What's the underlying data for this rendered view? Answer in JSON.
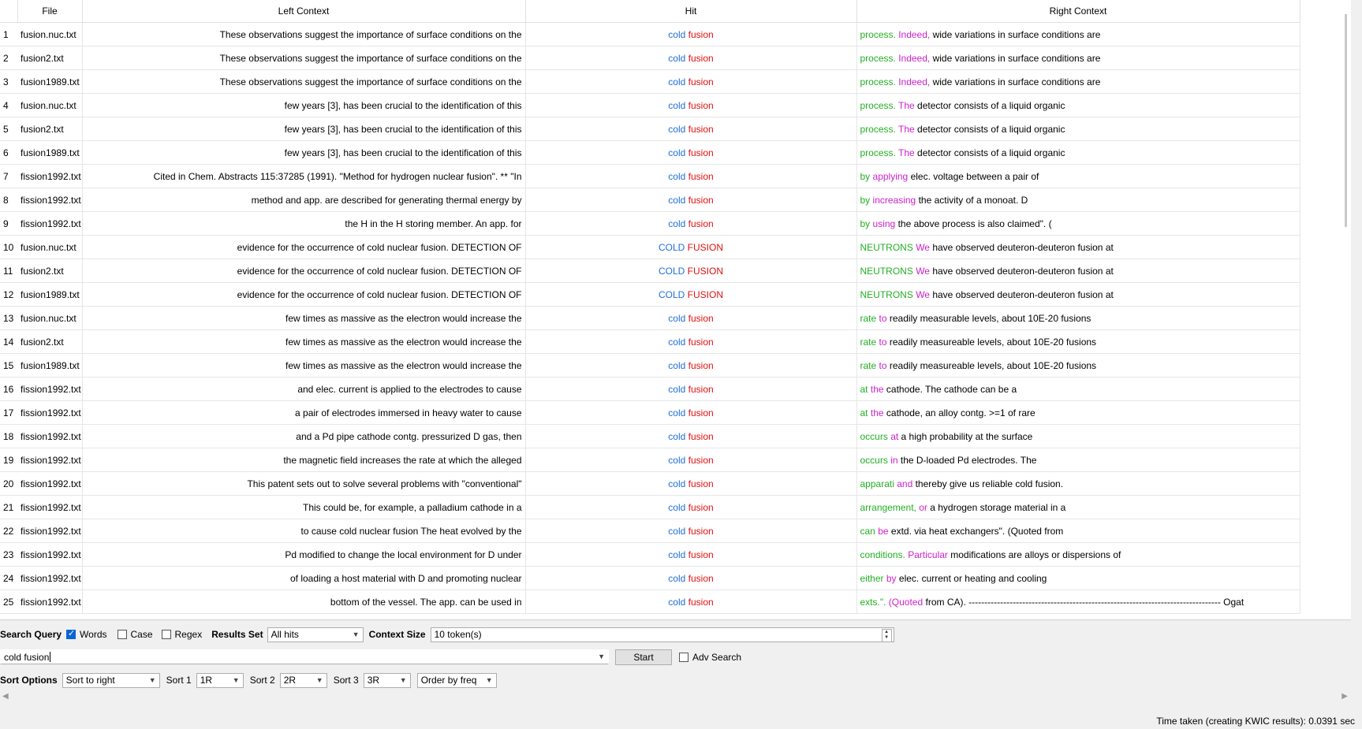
{
  "table": {
    "headers": {
      "file": "File",
      "left": "Left Context",
      "hit": "Hit",
      "right": "Right Context"
    },
    "rows": [
      {
        "n": "1",
        "file": "fusion.nuc.txt",
        "left": "These observations suggest the importance of surface conditions on the",
        "hit": [
          "cold",
          "fusion"
        ],
        "r1": "process.",
        "r2": "Indeed,",
        "rest": "wide variations in surface conditions are"
      },
      {
        "n": "2",
        "file": "fusion2.txt",
        "left": "These observations suggest the importance of surface conditions on the",
        "hit": [
          "cold",
          "fusion"
        ],
        "r1": "process.",
        "r2": "Indeed,",
        "rest": "wide variations in surface conditions are"
      },
      {
        "n": "3",
        "file": "fusion1989.txt",
        "left": "These observations suggest the importance of surface conditions on the",
        "hit": [
          "cold",
          "fusion"
        ],
        "r1": "process.",
        "r2": "Indeed,",
        "rest": "wide variations in surface conditions are"
      },
      {
        "n": "4",
        "file": "fusion.nuc.txt",
        "left": "few years [3], has been crucial to the identification of this",
        "hit": [
          "cold",
          "fusion"
        ],
        "r1": "process.",
        "r2": "The",
        "rest": "detector consists of a liquid organic"
      },
      {
        "n": "5",
        "file": "fusion2.txt",
        "left": "few years [3], has been crucial to the identification of this",
        "hit": [
          "cold",
          "fusion"
        ],
        "r1": "process.",
        "r2": "The",
        "rest": "detector consists of a liquid organic"
      },
      {
        "n": "6",
        "file": "fusion1989.txt",
        "left": "few years [3], has been crucial to the identification of this",
        "hit": [
          "cold",
          "fusion"
        ],
        "r1": "process.",
        "r2": "The",
        "rest": "detector consists of a liquid organic"
      },
      {
        "n": "7",
        "file": "fission1992.txt",
        "left": "Cited in Chem. Abstracts 115:37285 (1991). \"Method for hydrogen nuclear fusion\". ** \"In",
        "hit": [
          "cold",
          "fusion"
        ],
        "r1": "by",
        "r2": "applying",
        "rest": "elec. voltage between a pair of"
      },
      {
        "n": "8",
        "file": "fission1992.txt",
        "left": "method and app. are described for generating thermal energy by",
        "hit": [
          "cold",
          "fusion"
        ],
        "r1": "by",
        "r2": "increasing",
        "rest": "the activity of a monoat. D"
      },
      {
        "n": "9",
        "file": "fission1992.txt",
        "left": "the H in the H storing member. An app. for",
        "hit": [
          "cold",
          "fusion"
        ],
        "r1": "by",
        "r2": "using",
        "rest": "the above process is also claimed\". ("
      },
      {
        "n": "10",
        "file": "fusion.nuc.txt",
        "left": "evidence for the occurrence of cold nuclear fusion. DETECTION OF",
        "hit": [
          "COLD",
          "FUSION"
        ],
        "r1": "NEUTRONS",
        "r2": "We",
        "rest": "have observed deuteron-deuteron fusion at"
      },
      {
        "n": "11",
        "file": "fusion2.txt",
        "left": "evidence for the occurrence of cold nuclear fusion. DETECTION OF",
        "hit": [
          "COLD",
          "FUSION"
        ],
        "r1": "NEUTRONS",
        "r2": "We",
        "rest": "have observed deuteron-deuteron fusion at"
      },
      {
        "n": "12",
        "file": "fusion1989.txt",
        "left": "evidence for the occurrence of cold nuclear fusion. DETECTION OF",
        "hit": [
          "COLD",
          "FUSION"
        ],
        "r1": "NEUTRONS",
        "r2": "We",
        "rest": "have observed deuteron-deuteron fusion at"
      },
      {
        "n": "13",
        "file": "fusion.nuc.txt",
        "left": "few times as massive as the electron would increase the",
        "hit": [
          "cold",
          "fusion"
        ],
        "r1": "rate",
        "r2": "to",
        "rest": "readily measurable levels, about 10E-20 fusions"
      },
      {
        "n": "14",
        "file": "fusion2.txt",
        "left": "few times as massive as the electron would increase the",
        "hit": [
          "cold",
          "fusion"
        ],
        "r1": "rate",
        "r2": "to",
        "rest": "readily measureable levels, about 10E-20 fusions"
      },
      {
        "n": "15",
        "file": "fusion1989.txt",
        "left": "few times as massive as the electron would increase the",
        "hit": [
          "cold",
          "fusion"
        ],
        "r1": "rate",
        "r2": "to",
        "rest": "readily measureable levels, about 10E-20 fusions"
      },
      {
        "n": "16",
        "file": "fission1992.txt",
        "left": "and elec. current is applied to the electrodes to cause",
        "hit": [
          "cold",
          "fusion"
        ],
        "r1": "at",
        "r2": "the",
        "rest": "cathode. The cathode can be a"
      },
      {
        "n": "17",
        "file": "fission1992.txt",
        "left": "a pair of electrodes immersed in heavy water to cause",
        "hit": [
          "cold",
          "fusion"
        ],
        "r1": "at",
        "r2": "the",
        "rest": "cathode, an alloy contg. >=1 of rare"
      },
      {
        "n": "18",
        "file": "fission1992.txt",
        "left": "and a Pd pipe cathode contg. pressurized D gas, then",
        "hit": [
          "cold",
          "fusion"
        ],
        "r1": "occurs",
        "r2": "at",
        "rest": "a high probability at the surface"
      },
      {
        "n": "19",
        "file": "fission1992.txt",
        "left": "the magnetic field increases the rate at which the alleged",
        "hit": [
          "cold",
          "fusion"
        ],
        "r1": "occurs",
        "r2": "in",
        "rest": "the D-loaded Pd electrodes. The"
      },
      {
        "n": "20",
        "file": "fission1992.txt",
        "left": "This patent sets out to solve several problems with \"conventional\"",
        "hit": [
          "cold",
          "fusion"
        ],
        "r1": "apparati",
        "r2": "and",
        "rest": "thereby give us reliable cold fusion."
      },
      {
        "n": "21",
        "file": "fission1992.txt",
        "left": "This could be, for example, a palladium cathode in a",
        "hit": [
          "cold",
          "fusion"
        ],
        "r1": "arrangement,",
        "r2": "or",
        "rest": "a hydrogen storage material in a"
      },
      {
        "n": "22",
        "file": "fission1992.txt",
        "left": "to cause cold nuclear fusion The heat evolved by the",
        "hit": [
          "cold",
          "fusion"
        ],
        "r1": "can",
        "r2": "be",
        "rest": "extd. via heat exchangers\". (Quoted from"
      },
      {
        "n": "23",
        "file": "fission1992.txt",
        "left": "Pd modified to change the local environment for D under",
        "hit": [
          "cold",
          "fusion"
        ],
        "r1": "conditions.",
        "r2": "Particular",
        "rest": "modifications are alloys or dispersions of"
      },
      {
        "n": "24",
        "file": "fission1992.txt",
        "left": "of loading a host material with D and promoting nuclear",
        "hit": [
          "cold",
          "fusion"
        ],
        "r1": "either",
        "r2": "by",
        "rest": "elec. current or heating and cooling"
      },
      {
        "n": "25",
        "file": "fission1992.txt",
        "left": "bottom of the vessel. The app. can be used in",
        "hit": [
          "cold",
          "fusion"
        ],
        "r1": "exts.\".",
        "r2": "(Quoted",
        "rest": "from CA). -------------------------------------------------------------------------------- Ogat"
      }
    ]
  },
  "search": {
    "query_label": "Search Query",
    "words_label": "Words",
    "words_checked": true,
    "case_label": "Case",
    "regex_label": "Regex",
    "results_set_label": "Results Set",
    "results_set_value": "All hits",
    "context_size_label": "Context Size",
    "context_size_value": "10 token(s)",
    "query_value": "cold fusion",
    "start_label": "Start",
    "adv_label": "Adv Search"
  },
  "sort": {
    "options_label": "Sort Options",
    "mode_value": "Sort to right",
    "sort1_label": "Sort 1",
    "sort1_value": "1R",
    "sort2_label": "Sort 2",
    "sort2_value": "2R",
    "sort3_label": "Sort 3",
    "sort3_value": "3R",
    "order_value": "Order by freq"
  },
  "status": {
    "text": "Time taken (creating KWIC results):  0.0391 sec"
  },
  "colors": {
    "hit_word1": "#1e6fdc",
    "hit_word2": "#e01010",
    "right_word1": "#22b022",
    "right_word2": "#cc22cc"
  }
}
